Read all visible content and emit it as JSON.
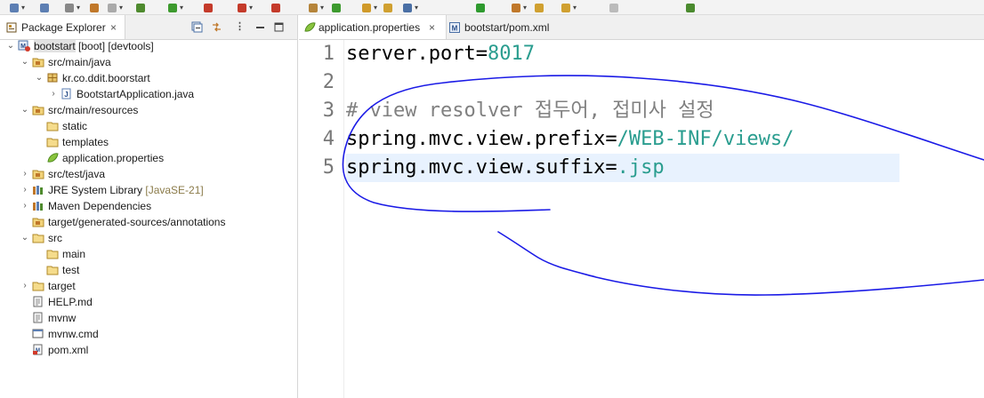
{
  "colors": {
    "value": "#2a9d8f",
    "comment": "#808080",
    "key": "#000000",
    "line_number": "#787878",
    "current_line": "#e8f2fe",
    "annotation_ink": "#1a1ae6",
    "selection": "#e2e2e2"
  },
  "toolbar": {
    "icons": [
      "new-icon",
      "save-icon",
      "save-all-icon",
      "undo-icon",
      "redo-icon",
      "debug-icon",
      "run-icon",
      "run-config-icon",
      "stop-icon",
      "external-tools-icon",
      "open-type-icon",
      "refresh-icon",
      "open-task-icon",
      "console-icon",
      "boot-dashboard-icon",
      "power-icon",
      "next-annotation-icon",
      "prev-annotation-icon",
      "back-icon",
      "forward-icon",
      "pin-icon"
    ]
  },
  "explorer": {
    "tab_label": "Package Explorer",
    "close_glyph": "×",
    "view_menu_glyph": "⋮",
    "tree": [
      {
        "label": "bootstart",
        "decoration": "[boot] [devtools]",
        "icon": "maven-project-icon",
        "expanded": true,
        "selected": true
      },
      {
        "label": "src/main/java",
        "icon": "source-folder-icon",
        "expanded": true
      },
      {
        "label": "kr.co.ddit.boorstart",
        "icon": "package-icon",
        "expanded": true
      },
      {
        "label": "BootstartApplication.java",
        "icon": "java-file-icon",
        "expanded": false
      },
      {
        "label": "src/main/resources",
        "icon": "source-folder-icon",
        "expanded": true
      },
      {
        "label": "static",
        "icon": "folder-icon"
      },
      {
        "label": "templates",
        "icon": "folder-icon"
      },
      {
        "label": "application.properties",
        "icon": "properties-file-icon"
      },
      {
        "label": "src/test/java",
        "icon": "source-folder-icon",
        "expanded": false
      },
      {
        "label": "JRE System Library",
        "decoration": "[JavaSE-21]",
        "icon": "library-icon",
        "expanded": false
      },
      {
        "label": "Maven Dependencies",
        "icon": "library-icon",
        "expanded": false
      },
      {
        "label": "target/generated-sources/annotations",
        "icon": "source-folder-icon"
      },
      {
        "label": "src",
        "icon": "folder-icon",
        "expanded": true
      },
      {
        "label": "main",
        "icon": "folder-icon"
      },
      {
        "label": "test",
        "icon": "folder-icon"
      },
      {
        "label": "target",
        "icon": "folder-icon",
        "expanded": false
      },
      {
        "label": "HELP.md",
        "icon": "text-file-icon"
      },
      {
        "label": "mvnw",
        "icon": "text-file-icon"
      },
      {
        "label": "mvnw.cmd",
        "icon": "cmd-file-icon"
      },
      {
        "label": "pom.xml",
        "icon": "xml-file-icon"
      }
    ]
  },
  "editor": {
    "tabs": [
      {
        "label": "application.properties",
        "close_glyph": "×",
        "active": true
      },
      {
        "label": "bootstart/pom.xml",
        "active": false
      }
    ],
    "lines": [
      {
        "number": "1",
        "key": "server.port=",
        "value": "8017",
        "comment": ""
      },
      {
        "number": "2",
        "key": "",
        "value": "",
        "comment": ""
      },
      {
        "number": "3",
        "key": "",
        "value": "",
        "comment": "# view resolver 접두어, 접미사 설정"
      },
      {
        "number": "4",
        "key": "spring.mvc.view.prefix=",
        "value": "/WEB-INF/views/",
        "comment": ""
      },
      {
        "number": "5",
        "key": "spring.mvc.view.suffix=",
        "value": ".jsp",
        "comment": ""
      }
    ],
    "current_line": "5"
  }
}
